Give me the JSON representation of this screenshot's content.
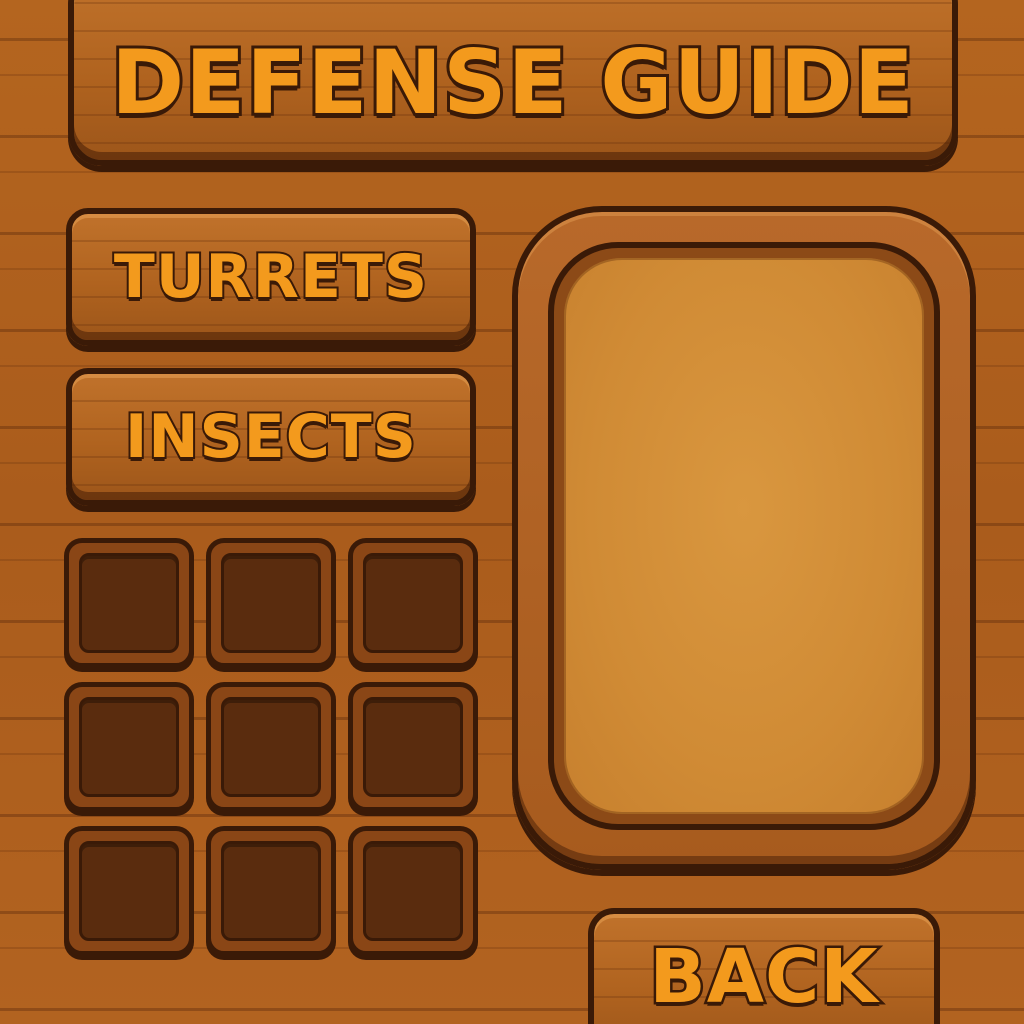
{
  "title": "DEFENSE GUIDE",
  "categories": {
    "turrets": "TURRETS",
    "insects": "INSECTS"
  },
  "slots": {
    "count": 9,
    "filled": 0
  },
  "back_label": "BACK",
  "colors": {
    "label_fill": "#f39a1d",
    "outline": "#3a1a07",
    "wood": "#b0601f",
    "slot_inner": "#5a2c0e",
    "info_screen": "#d08b35"
  }
}
